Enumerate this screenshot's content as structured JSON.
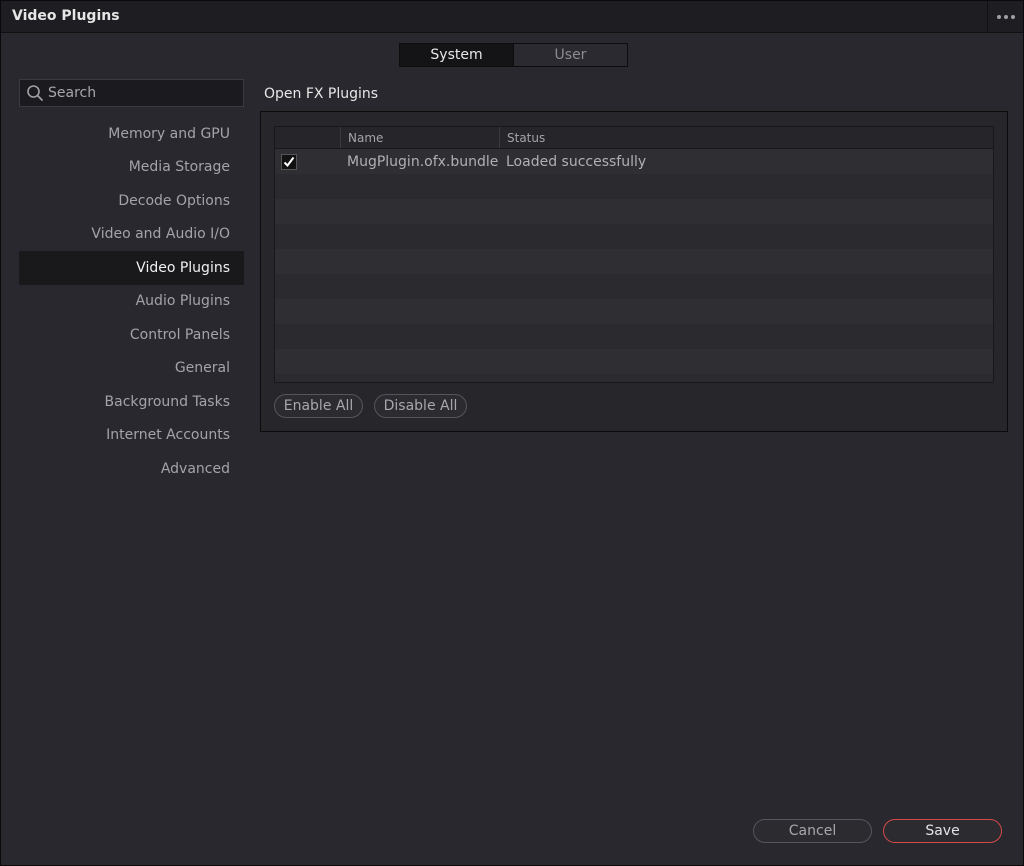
{
  "window": {
    "title": "Video Plugins"
  },
  "scope_tabs": [
    {
      "label": "System",
      "active": true
    },
    {
      "label": "User",
      "active": false
    }
  ],
  "search": {
    "placeholder": "Search",
    "value": ""
  },
  "sidebar": {
    "items": [
      {
        "label": "Memory and GPU",
        "active": false
      },
      {
        "label": "Media Storage",
        "active": false
      },
      {
        "label": "Decode Options",
        "active": false
      },
      {
        "label": "Video and Audio I/O",
        "active": false
      },
      {
        "label": "Video Plugins",
        "active": true
      },
      {
        "label": "Audio Plugins",
        "active": false
      },
      {
        "label": "Control Panels",
        "active": false
      },
      {
        "label": "General",
        "active": false
      },
      {
        "label": "Background Tasks",
        "active": false
      },
      {
        "label": "Internet Accounts",
        "active": false
      },
      {
        "label": "Advanced",
        "active": false
      }
    ]
  },
  "main": {
    "section_title": "Open FX Plugins",
    "table": {
      "columns": [
        "",
        "Name",
        "Status"
      ],
      "rows": [
        {
          "enabled": true,
          "name": "MugPlugin.ofx.bundle",
          "status": "Loaded successfully"
        }
      ]
    },
    "enable_all_label": "Enable All",
    "disable_all_label": "Disable All"
  },
  "footer": {
    "cancel_label": "Cancel",
    "save_label": "Save"
  },
  "colors": {
    "accent": "#d44a4a",
    "background": "#28282e",
    "selected_nav": "#19191c"
  }
}
